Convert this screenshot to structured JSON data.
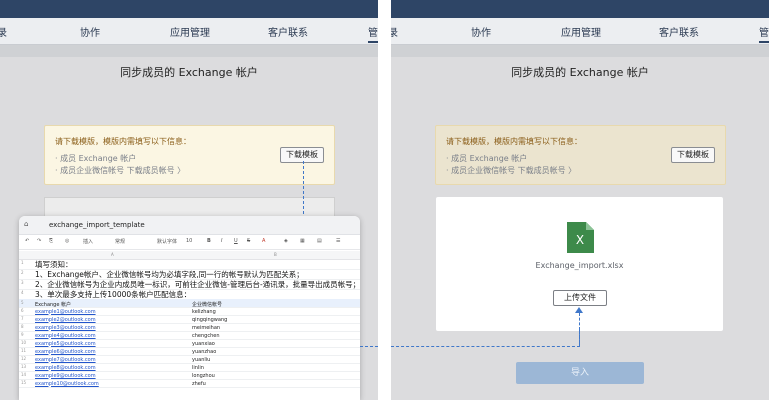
{
  "nav": {
    "tabs": [
      "录",
      "协作",
      "应用管理",
      "客户联系",
      "管"
    ]
  },
  "page_title": "同步成员的 Exchange 帐户",
  "notice": {
    "title": "请下载模版，模版内需填写以下信息：",
    "line1": "· 成员 Exchange 帐户",
    "line2": "· 成员企业微信帐号   下载成员帐号 〉",
    "download_button": "下载模板"
  },
  "upload": {
    "file_name": "Exchange_import.xlsx",
    "upload_button": "上传文件",
    "import_button": "导入",
    "file_icon_label": "X"
  },
  "sheet": {
    "title": "exchange_import_template",
    "toolbar": [
      "插入",
      "常规",
      "默认字体",
      "10",
      "B",
      "I",
      "U",
      "S",
      "A"
    ],
    "col_a": "A",
    "col_b": "B",
    "rows": [
      {
        "n": "1",
        "a": "填写须知：",
        "b": "",
        "style": "big"
      },
      {
        "n": "2",
        "a": "1、Exchange帐户、企业微信帐号均为必填字段,同一行的帐号默认为匹配关系；",
        "b": "",
        "style": "big"
      },
      {
        "n": "3",
        "a": "2、企业微信帐号为企业内成员唯一标识，可前往企业微信-管理后台-通讯录，批量导出成员帐号；",
        "b": "",
        "style": "big"
      },
      {
        "n": "4",
        "a": "3、单次最多支持上传10000条帐户匹配信息：",
        "b": "",
        "style": "big"
      },
      {
        "n": "5",
        "a": "Exchange 帐户",
        "b": "企业微信帐号",
        "style": "header"
      },
      {
        "n": "6",
        "a": "example1@outlook.com",
        "b": "kelizhang",
        "style": "data"
      },
      {
        "n": "7",
        "a": "example2@outlook.com",
        "b": "qingqingwang",
        "style": "data"
      },
      {
        "n": "8",
        "a": "example3@outlook.com",
        "b": "meimeihan",
        "style": "data"
      },
      {
        "n": "9",
        "a": "example4@outlook.com",
        "b": "chengchen",
        "style": "data"
      },
      {
        "n": "10",
        "a": "example5@outlook.com",
        "b": "yuanxiao",
        "style": "data"
      },
      {
        "n": "11",
        "a": "example6@outlook.com",
        "b": "yuanzhao",
        "style": "data"
      },
      {
        "n": "12",
        "a": "example7@outlook.com",
        "b": "yuanliu",
        "style": "data"
      },
      {
        "n": "13",
        "a": "example8@outlook.com",
        "b": "linlin",
        "style": "data"
      },
      {
        "n": "14",
        "a": "example9@outlook.com",
        "b": "longzhou",
        "style": "data"
      },
      {
        "n": "15",
        "a": "example10@outlook.com",
        "b": "zhefu",
        "style": "data"
      }
    ]
  },
  "colors": {
    "topbar": "#2e4566",
    "accent": "#3f77c9",
    "excel_green": "#3d8a4a"
  }
}
